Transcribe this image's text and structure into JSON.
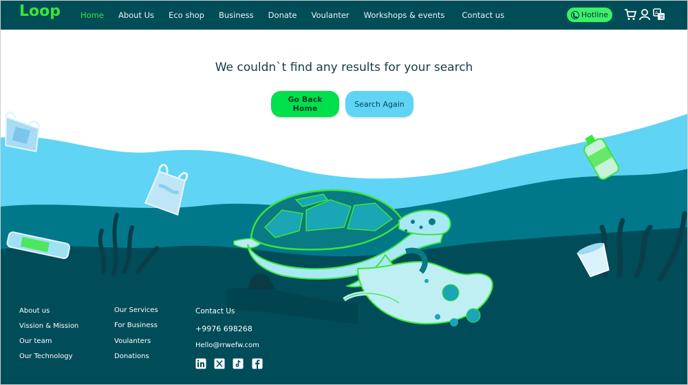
{
  "brand": {
    "logo": "Loop"
  },
  "nav": {
    "items": [
      {
        "label": "Home",
        "active": true
      },
      {
        "label": "About Us"
      },
      {
        "label": "Eco shop"
      },
      {
        "label": "Business"
      },
      {
        "label": "Donate"
      },
      {
        "label": "Voulanter"
      },
      {
        "label": "Workshops & events"
      },
      {
        "label": "Contact us"
      }
    ],
    "hotline": "Hotline",
    "icons": [
      "cart-icon",
      "user-icon",
      "language-icon"
    ]
  },
  "main": {
    "message": "We couldn`t find any results for your search",
    "home_button": "Go Back Home",
    "search_button": "Search Again"
  },
  "footer": {
    "col1": [
      "About us",
      "Vission & Mission",
      "Our team",
      "Our Technology"
    ],
    "col2": [
      "Our Services",
      "For Business",
      "Voulanters",
      "Donations"
    ],
    "contact_title": "Contact Us",
    "phone": "+9976 698268",
    "email": "Hello@rrwefw.com",
    "social": [
      "linkedin-icon",
      "x-icon",
      "tiktok-icon",
      "facebook-icon"
    ]
  },
  "colors": {
    "nav_bg": "#004d57",
    "accent_green": "#39e639",
    "light_water": "#5fd4f4",
    "mid_water": "#00788a",
    "deep_water": "#004c59"
  }
}
